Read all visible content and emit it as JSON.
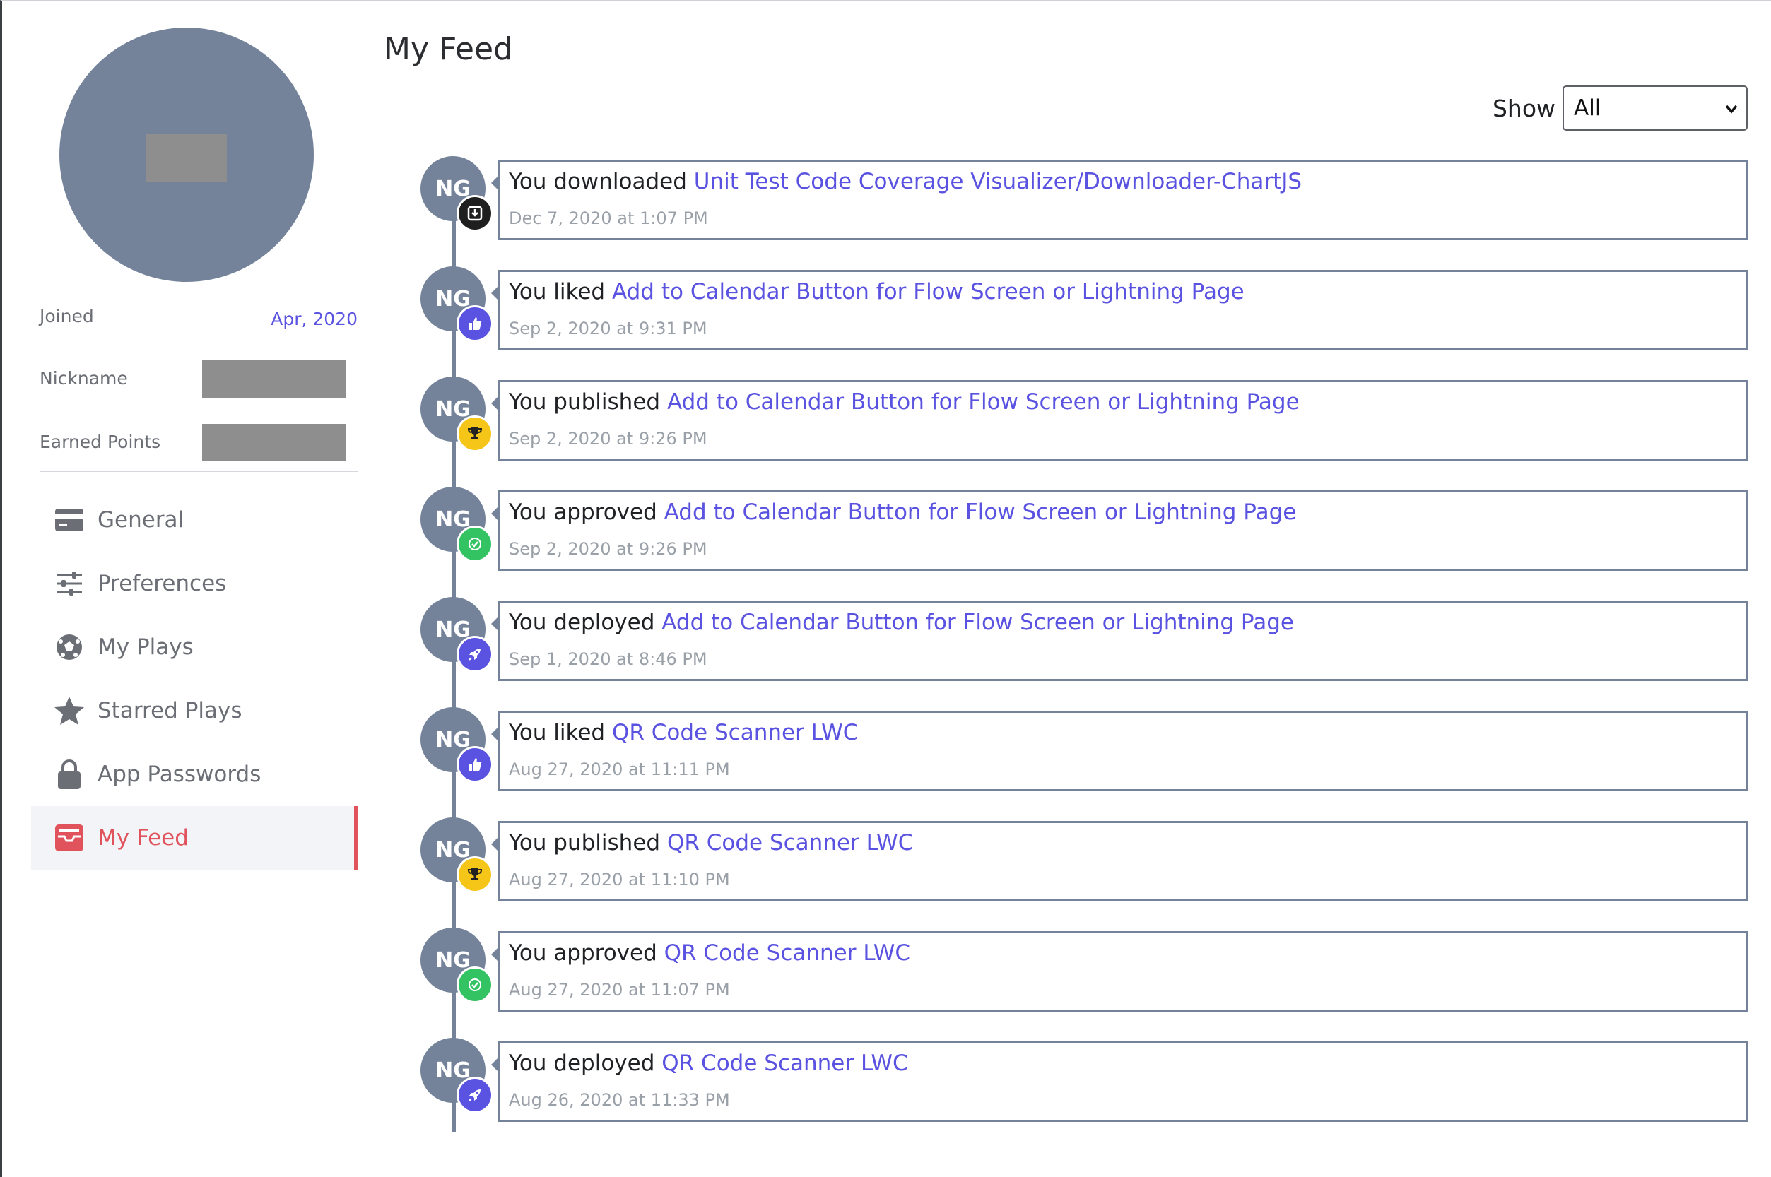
{
  "profile": {
    "joined_label": "Joined",
    "joined_value": "Apr, 2020",
    "nickname_label": "Nickname",
    "points_label": "Earned Points"
  },
  "nav": [
    {
      "label": "General",
      "icon": "card-icon"
    },
    {
      "label": "Preferences",
      "icon": "sliders-icon"
    },
    {
      "label": "My Plays",
      "icon": "soccer-ball-icon"
    },
    {
      "label": "Starred Plays",
      "icon": "star-icon"
    },
    {
      "label": "App Passwords",
      "icon": "lock-icon"
    },
    {
      "label": "My Feed",
      "icon": "inbox-icon",
      "active": true
    }
  ],
  "main": {
    "title": "My Feed",
    "show_label": "Show",
    "show_value": "All"
  },
  "colors": {
    "accent": "#5a52e0",
    "active": "#e0535d",
    "avatar": "#74839a",
    "download_badge": "#1f1f1f",
    "like_badge": "#5a52e0",
    "publish_badge": "#f5c518",
    "approve_badge": "#34c363",
    "deploy_badge": "#5a52e0"
  },
  "feed": [
    {
      "initials": "NG",
      "action": "You downloaded",
      "target": "Unit Test Code Coverage Visualizer/Downloader-ChartJS",
      "time": "Dec 7, 2020 at 1:07 PM",
      "badge": "download-icon"
    },
    {
      "initials": "NG",
      "action": "You liked",
      "target": "Add to Calendar Button for Flow Screen or Lightning Page",
      "time": "Sep 2, 2020 at 9:31 PM",
      "badge": "thumbs-up-icon"
    },
    {
      "initials": "NG",
      "action": "You published",
      "target": "Add to Calendar Button for Flow Screen or Lightning Page",
      "time": "Sep 2, 2020 at 9:26 PM",
      "badge": "trophy-icon"
    },
    {
      "initials": "NG",
      "action": "You approved",
      "target": "Add to Calendar Button for Flow Screen or Lightning Page",
      "time": "Sep 2, 2020 at 9:26 PM",
      "badge": "check-icon"
    },
    {
      "initials": "NG",
      "action": "You deployed",
      "target": "Add to Calendar Button for Flow Screen or Lightning Page",
      "time": "Sep 1, 2020 at 8:46 PM",
      "badge": "rocket-icon"
    },
    {
      "initials": "NG",
      "action": "You liked",
      "target": "QR Code Scanner LWC",
      "time": "Aug 27, 2020 at 11:11 PM",
      "badge": "thumbs-up-icon"
    },
    {
      "initials": "NG",
      "action": "You published",
      "target": "QR Code Scanner LWC",
      "time": "Aug 27, 2020 at 11:10 PM",
      "badge": "trophy-icon"
    },
    {
      "initials": "NG",
      "action": "You approved",
      "target": "QR Code Scanner LWC",
      "time": "Aug 27, 2020 at 11:07 PM",
      "badge": "check-icon"
    },
    {
      "initials": "NG",
      "action": "You deployed",
      "target": "QR Code Scanner LWC",
      "time": "Aug 26, 2020 at 11:33 PM",
      "badge": "rocket-icon"
    }
  ]
}
